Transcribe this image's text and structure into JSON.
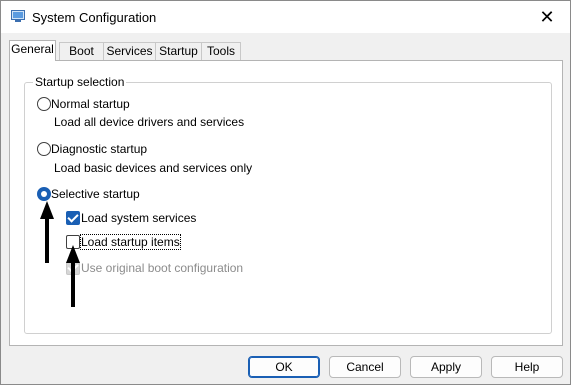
{
  "window": {
    "title": "System Configuration",
    "icon": "system-config-icon",
    "close_glyph": "✕"
  },
  "tabs": [
    {
      "label": "General",
      "active": true
    },
    {
      "label": "Boot"
    },
    {
      "label": "Services"
    },
    {
      "label": "Startup"
    },
    {
      "label": "Tools"
    }
  ],
  "startup_selection": {
    "legend": "Startup selection",
    "options": [
      {
        "label": "Normal startup",
        "description": "Load all device drivers and services",
        "checked": false
      },
      {
        "label": "Diagnostic startup",
        "description": "Load basic devices and services only",
        "checked": false
      },
      {
        "label": "Selective startup",
        "checked": true
      }
    ],
    "checkboxes": [
      {
        "label": "Load system services",
        "checked": true,
        "enabled": true
      },
      {
        "label": "Load startup items",
        "checked": false,
        "enabled": true
      },
      {
        "label": "Use original boot configuration",
        "checked": true,
        "enabled": false
      }
    ]
  },
  "buttons": {
    "ok": "OK",
    "cancel": "Cancel",
    "apply": "Apply",
    "help": "Help"
  },
  "colors": {
    "accent": "#1a5fb4",
    "annotation_arrow": "#000000"
  }
}
